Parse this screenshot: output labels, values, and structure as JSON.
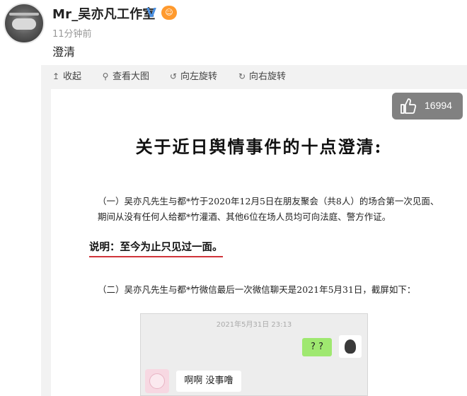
{
  "post": {
    "username": "Mr_吴亦凡工作室",
    "verified_mark": "V",
    "timestamp": "11分钟前",
    "text": "澄清"
  },
  "toolbar": {
    "collapse": "收起",
    "view_large": "查看大图",
    "rotate_left": "向左旋转",
    "rotate_right": "向右旋转"
  },
  "like": {
    "count": "16994"
  },
  "document": {
    "title": "关于近日舆情事件的十点澄清:",
    "para1": "（一）吴亦凡先生与都*竹于2020年12月5日在朋友聚会（共8人）的场合第一次见面、期间从没有任何人给都*竹灌酒、其他6位在场人员均可向法庭、警方作证。",
    "note": "说明：至今为止只见过一面。",
    "para2": "（二）吴亦凡先生与都*竹微信最后一次微信聊天是2021年5月31日，截屏如下："
  },
  "chat": {
    "date": "2021年5月31日 23:13",
    "right_message": "? ?",
    "left_message": "啊啊 没事噜"
  },
  "colors": {
    "verified": "#4a90e2",
    "underline": "#d0343a",
    "chat_bubble_right": "#9fe870"
  }
}
